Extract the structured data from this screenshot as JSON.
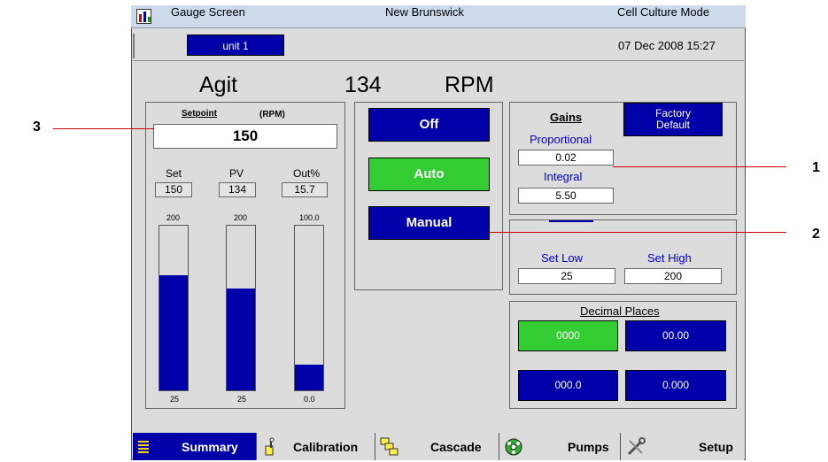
{
  "titlebar": {
    "left": "Gauge Screen",
    "center": "New Brunswick",
    "right": "Cell Culture Mode"
  },
  "subbar": {
    "unit_button": "unit 1",
    "datetime": "07 Dec 2008   15:27"
  },
  "reading": {
    "name": "Agit",
    "value": "134",
    "unit": "RPM"
  },
  "setpoint": {
    "title": "Setpoint",
    "unit": "(RPM)",
    "value": "150"
  },
  "status": {
    "headers": [
      "Set",
      "PV",
      "Out%"
    ],
    "values": [
      "150",
      "134",
      "15.7"
    ]
  },
  "bars": [
    {
      "top": "200",
      "bottom": "25",
      "fill": 0.7
    },
    {
      "top": "200",
      "bottom": "25",
      "fill": 0.62
    },
    {
      "top": "100.0",
      "bottom": "0.0",
      "fill": 0.157
    }
  ],
  "modes": {
    "off": "Off",
    "auto": "Auto",
    "manual": "Manual"
  },
  "gains": {
    "title": "Gains",
    "factory_default": "Factory\nDefault",
    "proportional_label": "Proportional",
    "proportional_value": "0.02",
    "integral_label": "Integral",
    "integral_value": "5.50"
  },
  "limits": {
    "low_label": "Set Low",
    "low_value": "25",
    "high_label": "Set High",
    "high_value": "200"
  },
  "decimals": {
    "title": "Decimal Places",
    "options": [
      "0000",
      "00.00",
      "000.0",
      "0.000"
    ],
    "selected": "0000"
  },
  "tabs": [
    "Summary",
    "Calibration",
    "Cascade",
    "Pumps",
    "Setup"
  ],
  "callouts": [
    "3",
    "1",
    "2"
  ],
  "colors": {
    "accent_blue": "#0000aa",
    "selected_green": "#33cc33",
    "callout_red": "#cc0000"
  }
}
